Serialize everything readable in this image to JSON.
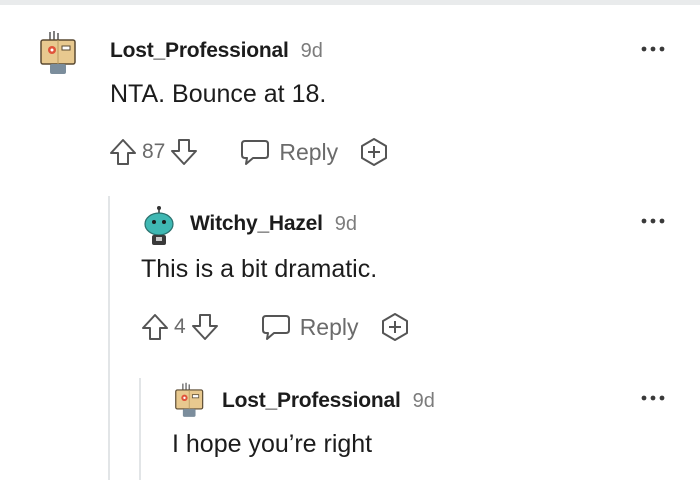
{
  "comments": [
    {
      "username": "Lost_Professional",
      "age": "9d",
      "text": "NTA. Bounce at 18.",
      "votes": "87",
      "reply_label": "Reply"
    },
    {
      "username": "Witchy_Hazel",
      "age": "9d",
      "text": "This is a bit dramatic.",
      "votes": "4",
      "reply_label": "Reply"
    },
    {
      "username": "Lost_Professional",
      "age": "9d",
      "text": "I hope you’re right"
    }
  ],
  "more_label": "•••",
  "icons": {
    "upvote": "upvote-icon",
    "downvote": "downvote-icon",
    "reply": "reply-bubble-icon",
    "award": "award-icon",
    "more": "more-options-icon"
  },
  "colors": {
    "text": "#1c1c1c",
    "muted": "#7c7c7c",
    "thread_line": "#e2e5e7"
  }
}
